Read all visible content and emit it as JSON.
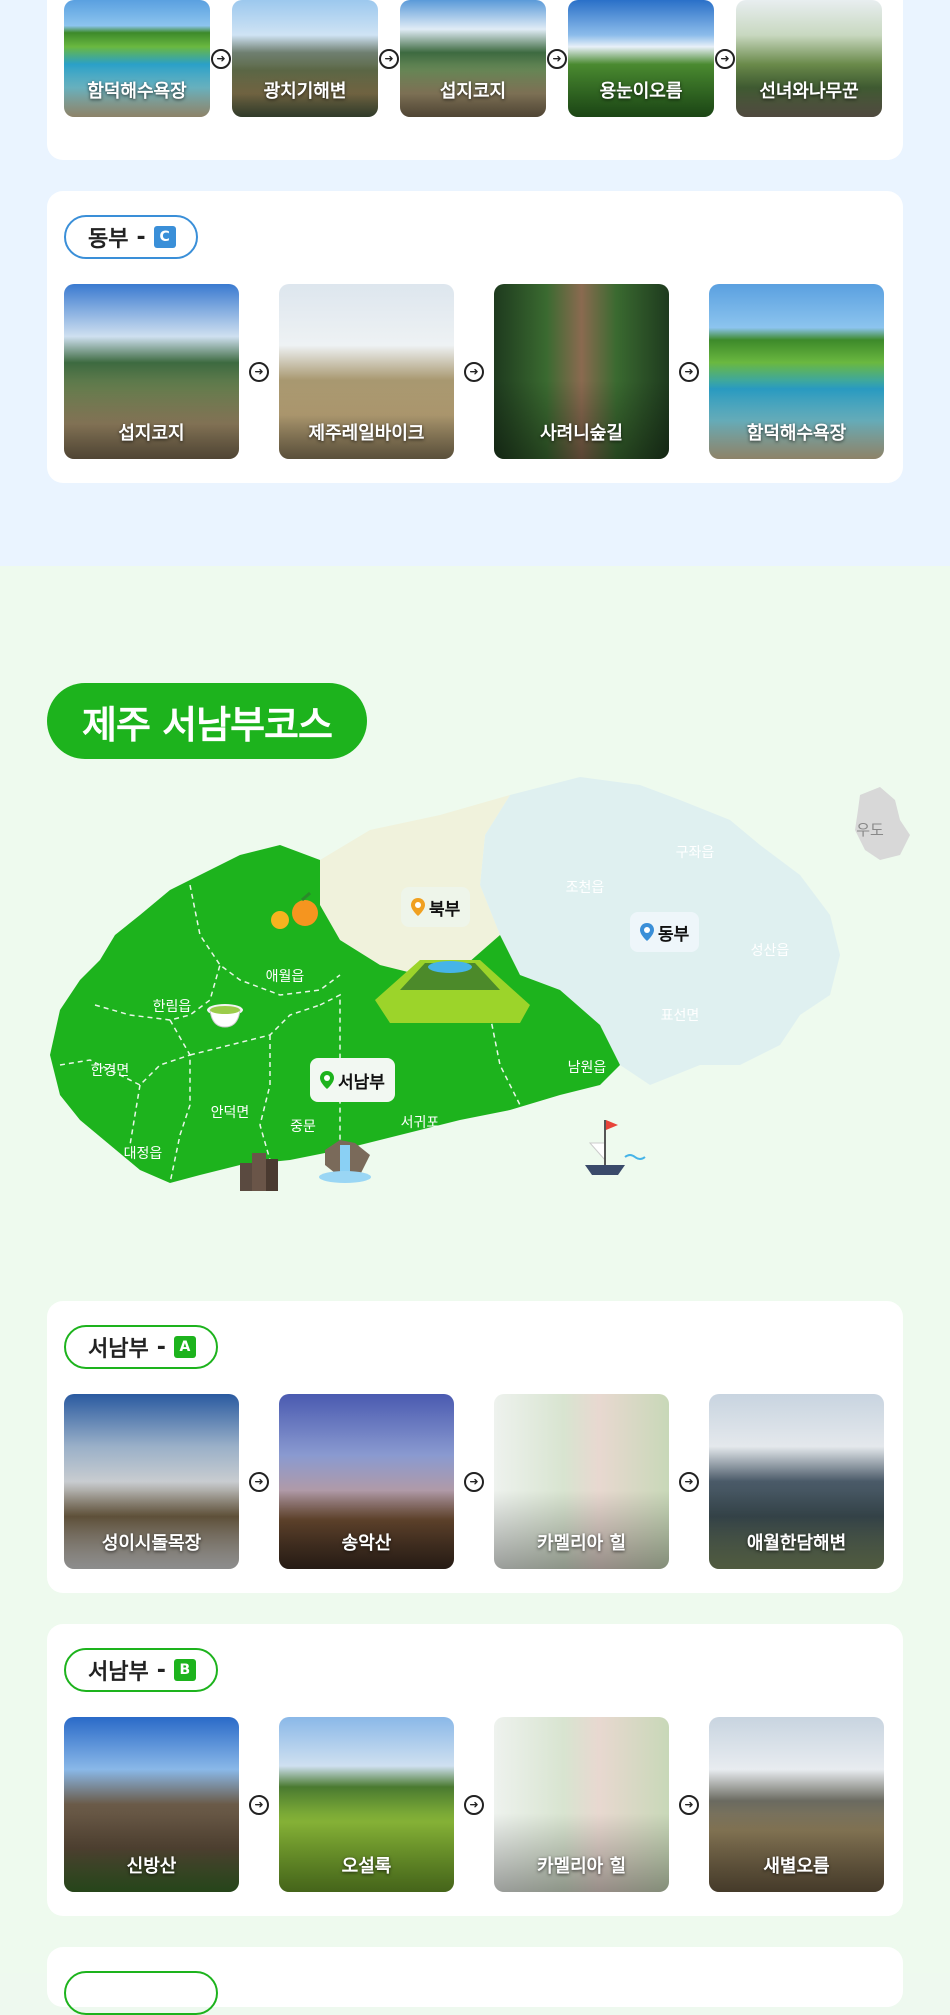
{
  "top_row": {
    "items": [
      {
        "label": "함덕해수욕장"
      },
      {
        "label": "광치기해변"
      },
      {
        "label": "섭지코지"
      },
      {
        "label": "용눈이오름"
      },
      {
        "label": "선녀와나무꾼"
      }
    ]
  },
  "east_c": {
    "region": "동부",
    "dash": "-",
    "code": "C",
    "items": [
      {
        "label": "섭지코지"
      },
      {
        "label": "제주레일바이크"
      },
      {
        "label": "사려니숲길"
      },
      {
        "label": "함덕해수욕장"
      }
    ]
  },
  "southwest": {
    "title": "제주 서남부코스",
    "map": {
      "north_tag": "북부",
      "east_tag": "동부",
      "southwest_tag": "서남부",
      "udo": "우도",
      "towns": {
        "gujwa": "구좌읍",
        "jocheon": "조천읍",
        "seongsan": "성산읍",
        "pyoseon": "표선면",
        "namwon": "남원읍",
        "seogwipo": "서귀포",
        "jungmun": "중문",
        "andeok": "안덕면",
        "daejeong": "대정읍",
        "hangyeong": "한경면",
        "hallim": "한림읍",
        "aewol": "애월읍"
      }
    },
    "course_a": {
      "region": "서남부",
      "dash": "-",
      "code": "A",
      "items": [
        {
          "label": "성이시돌목장"
        },
        {
          "label": "송악산"
        },
        {
          "label": "카멜리아 힐"
        },
        {
          "label": "애월한담해변"
        }
      ]
    },
    "course_b": {
      "region": "서남부",
      "dash": "-",
      "code": "B",
      "items": [
        {
          "label": "신방산"
        },
        {
          "label": "오설록"
        },
        {
          "label": "카멜리아 힐"
        },
        {
          "label": "새별오름"
        }
      ]
    }
  },
  "colors": {
    "east_accent": "#3a8fd8",
    "southwest_accent": "#1db31d",
    "north_region": "#f0f2dc",
    "east_region": "#dff0f0"
  }
}
